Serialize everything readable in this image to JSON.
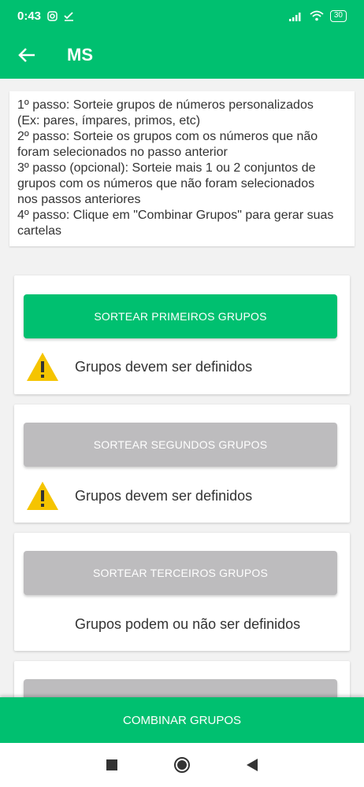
{
  "status_bar": {
    "time": "0:43",
    "battery": "30"
  },
  "app_bar": {
    "title": "MS"
  },
  "instructions": {
    "lines": [
      "1º passo: Sorteie grupos de números personalizados",
      "(Ex: pares, ímpares, primos, etc)",
      "2º passo: Sorteie os grupos com os números que não",
      "foram selecionados no passo anterior",
      "3º passo (opcional): Sorteie mais 1 ou 2 conjuntos de",
      "grupos com os números que não foram selecionados",
      "nos passos anteriores",
      "4º passo: Clique em \"Combinar Grupos\" para gerar suas",
      "cartelas"
    ]
  },
  "steps": [
    {
      "button": "SORTEAR PRIMEIROS GRUPOS",
      "message": "Grupos devem ser definidos"
    },
    {
      "button": "SORTEAR SEGUNDOS GRUPOS",
      "message": "Grupos devem ser definidos"
    },
    {
      "button": "SORTEAR TERCEIROS GRUPOS",
      "message": "Grupos podem ou não ser definidos"
    }
  ],
  "combine_button": "COMBINAR GRUPOS",
  "colors": {
    "primary": "#00c070",
    "disabled": "#bdbcbe",
    "warning": "#f5c400"
  }
}
